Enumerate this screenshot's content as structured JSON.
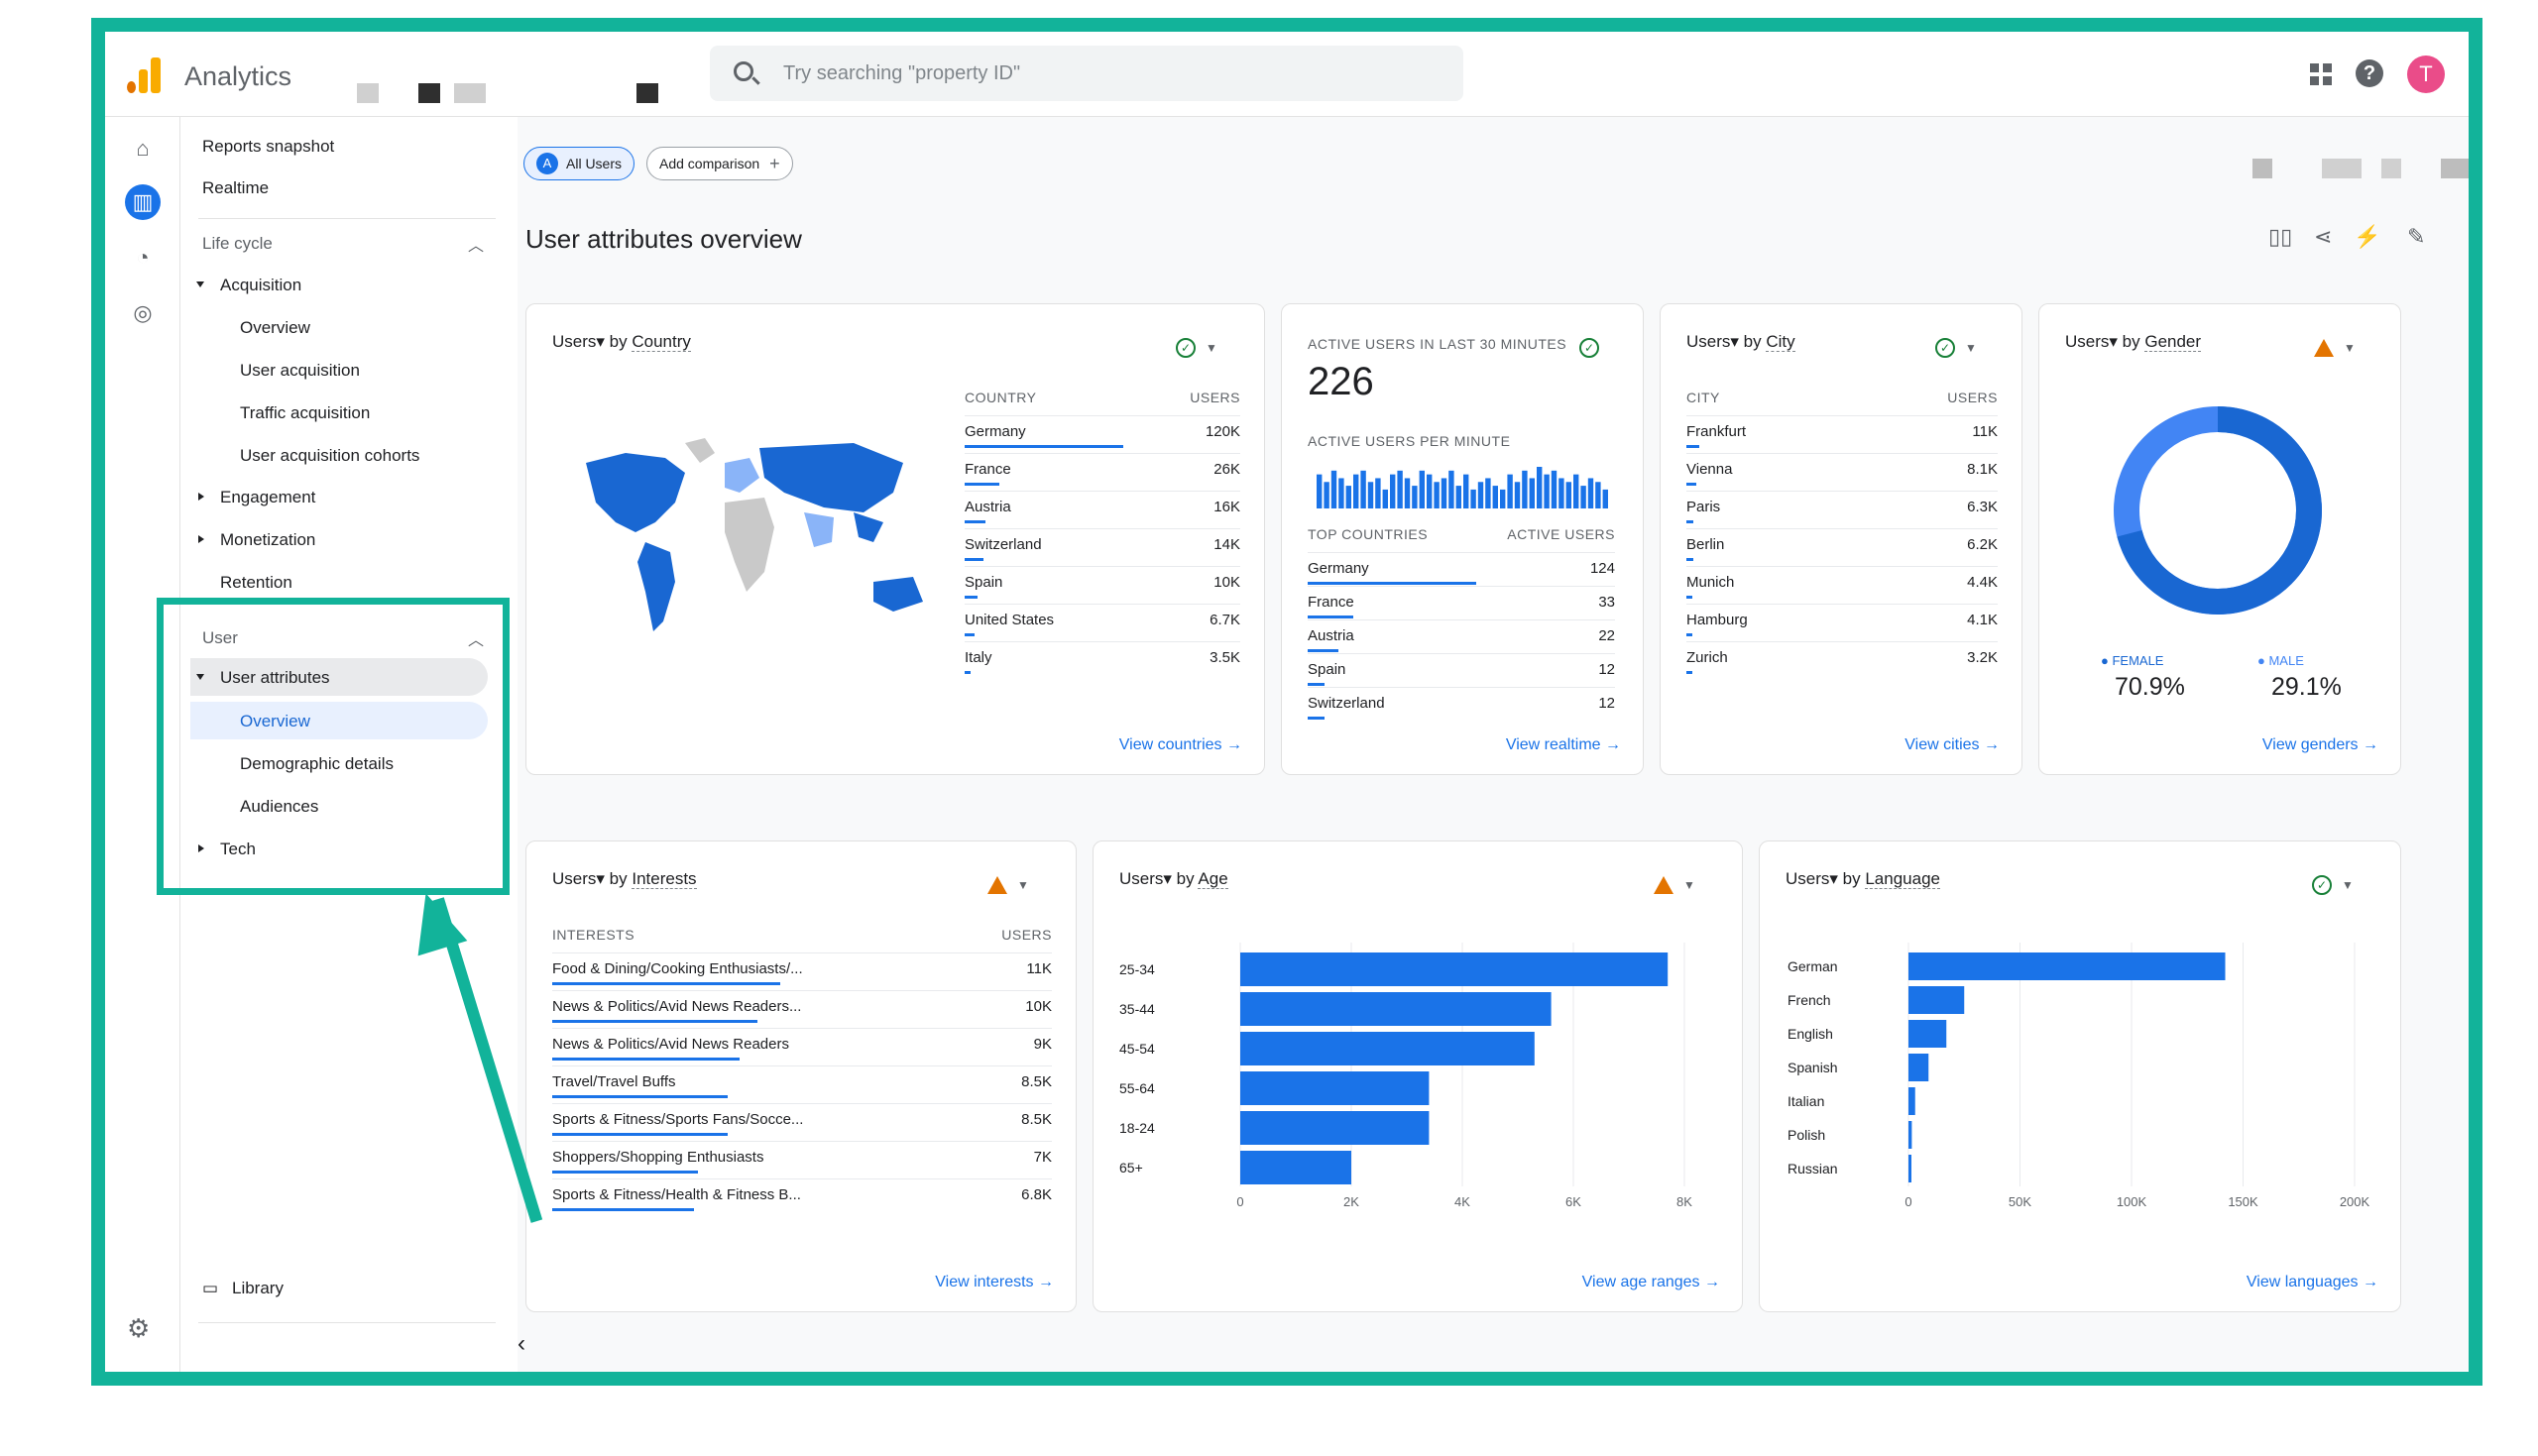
{
  "app": {
    "title": "Analytics",
    "avatar_letter": "T"
  },
  "search": {
    "placeholder": "Try searching \"property ID\""
  },
  "nav": {
    "reports_snapshot": "Reports snapshot",
    "realtime": "Realtime",
    "life_cycle": "Life cycle",
    "acquisition": "Acquisition",
    "acq_overview": "Overview",
    "user_acquisition": "User acquisition",
    "traffic_acquisition": "Traffic acquisition",
    "user_acq_cohorts": "User acquisition cohorts",
    "engagement": "Engagement",
    "monetization": "Monetization",
    "retention": "Retention",
    "user": "User",
    "user_attributes": "User attributes",
    "ua_overview": "Overview",
    "demographic_details": "Demographic details",
    "audiences": "Audiences",
    "tech": "Tech",
    "library": "Library"
  },
  "comparison": {
    "all_users_badge": "A",
    "all_users": "All Users",
    "add_comparison": "Add comparison",
    "plus": "+"
  },
  "page": {
    "title": "User attributes overview"
  },
  "country_card": {
    "title_prefix": "Users",
    "title_dim": "Country",
    "col_dim": "COUNTRY",
    "col_users": "USERS",
    "rows": [
      {
        "name": "Germany",
        "value": "120K",
        "frac": 1.0
      },
      {
        "name": "France",
        "value": "26K",
        "frac": 0.22
      },
      {
        "name": "Austria",
        "value": "16K",
        "frac": 0.13
      },
      {
        "name": "Switzerland",
        "value": "14K",
        "frac": 0.12
      },
      {
        "name": "Spain",
        "value": "10K",
        "frac": 0.08
      },
      {
        "name": "United States",
        "value": "6.7K",
        "frac": 0.06
      },
      {
        "name": "Italy",
        "value": "3.5K",
        "frac": 0.03
      }
    ],
    "link": "View countries →"
  },
  "realtime_card": {
    "title": "ACTIVE USERS IN LAST 30 MINUTES",
    "count": "226",
    "per_minute": "ACTIVE USERS PER MINUTE",
    "col_dim": "TOP COUNTRIES",
    "col_users": "ACTIVE USERS",
    "rows": [
      {
        "name": "Germany",
        "value": "124",
        "frac": 1.0
      },
      {
        "name": "France",
        "value": "33",
        "frac": 0.27
      },
      {
        "name": "Austria",
        "value": "22",
        "frac": 0.18
      },
      {
        "name": "Spain",
        "value": "12",
        "frac": 0.1
      },
      {
        "name": "Switzerland",
        "value": "12",
        "frac": 0.1
      }
    ],
    "sparkline": [
      9,
      7,
      10,
      8,
      6,
      9,
      10,
      7,
      8,
      5,
      9,
      10,
      8,
      6,
      10,
      9,
      7,
      8,
      10,
      6,
      9,
      5,
      7,
      8,
      6,
      5,
      9,
      7,
      10,
      8,
      11,
      9,
      10,
      8,
      7,
      9,
      6,
      8,
      7,
      5
    ],
    "link": "View realtime →"
  },
  "city_card": {
    "title_prefix": "Users",
    "title_dim": "City",
    "col_dim": "CITY",
    "col_users": "USERS",
    "rows": [
      {
        "name": "Frankfurt",
        "value": "11K",
        "frac": 0.11
      },
      {
        "name": "Vienna",
        "value": "8.1K",
        "frac": 0.08
      },
      {
        "name": "Paris",
        "value": "6.3K",
        "frac": 0.06
      },
      {
        "name": "Berlin",
        "value": "6.2K",
        "frac": 0.06
      },
      {
        "name": "Munich",
        "value": "4.4K",
        "frac": 0.05
      },
      {
        "name": "Hamburg",
        "value": "4.1K",
        "frac": 0.05
      },
      {
        "name": "Zurich",
        "value": "3.2K",
        "frac": 0.04
      }
    ],
    "link": "View cities →"
  },
  "gender_card": {
    "title_prefix": "Users",
    "title_dim": "Gender",
    "female_label": "● FEMALE",
    "female_value": "70.9%",
    "male_label": "● MALE",
    "male_value": "29.1%",
    "female_frac": 0.709,
    "link": "View genders →"
  },
  "interests_card": {
    "title_prefix": "Users",
    "title_dim": "Interests",
    "col_dim": "INTERESTS",
    "col_users": "USERS",
    "rows": [
      {
        "name": "Food & Dining/Cooking Enthusiasts/...",
        "value": "11K",
        "frac": 1.0
      },
      {
        "name": "News & Politics/Avid News Readers...",
        "value": "10K",
        "frac": 0.9
      },
      {
        "name": "News & Politics/Avid News Readers",
        "value": "9K",
        "frac": 0.82
      },
      {
        "name": "Travel/Travel Buffs",
        "value": "8.5K",
        "frac": 0.77
      },
      {
        "name": "Sports & Fitness/Sports Fans/Socce...",
        "value": "8.5K",
        "frac": 0.77
      },
      {
        "name": "Shoppers/Shopping Enthusiasts",
        "value": "7K",
        "frac": 0.64
      },
      {
        "name": "Sports & Fitness/Health & Fitness B...",
        "value": "6.8K",
        "frac": 0.62
      }
    ],
    "link": "View interests →"
  },
  "age_card": {
    "title_prefix": "Users",
    "title_dim": "Age",
    "link": "View age ranges →"
  },
  "language_card": {
    "title_prefix": "Users",
    "title_dim": "Language",
    "link": "View languages →"
  },
  "chart_data": [
    {
      "type": "bar",
      "orientation": "horizontal",
      "categories": [
        "25-34",
        "35-44",
        "45-54",
        "55-64",
        "18-24",
        "65+"
      ],
      "values": [
        7700,
        5600,
        5300,
        3400,
        3400,
        2000
      ],
      "xlim": [
        0,
        8000
      ],
      "xticks": [
        "0",
        "2K",
        "4K",
        "6K",
        "8K"
      ],
      "color": "#1a73e8"
    },
    {
      "type": "bar",
      "orientation": "horizontal",
      "categories": [
        "German",
        "French",
        "English",
        "Spanish",
        "Italian",
        "Polish",
        "Russian"
      ],
      "values": [
        142000,
        25000,
        17000,
        9000,
        3000,
        1500,
        1000
      ],
      "xlim": [
        0,
        200000
      ],
      "xticks": [
        "0",
        "50K",
        "100K",
        "150K",
        "200K"
      ],
      "color": "#1a73e8"
    }
  ],
  "colors": {
    "accent": "#1a73e8",
    "frame": "#12b39a",
    "warn": "#e37400",
    "ok": "#188038"
  }
}
